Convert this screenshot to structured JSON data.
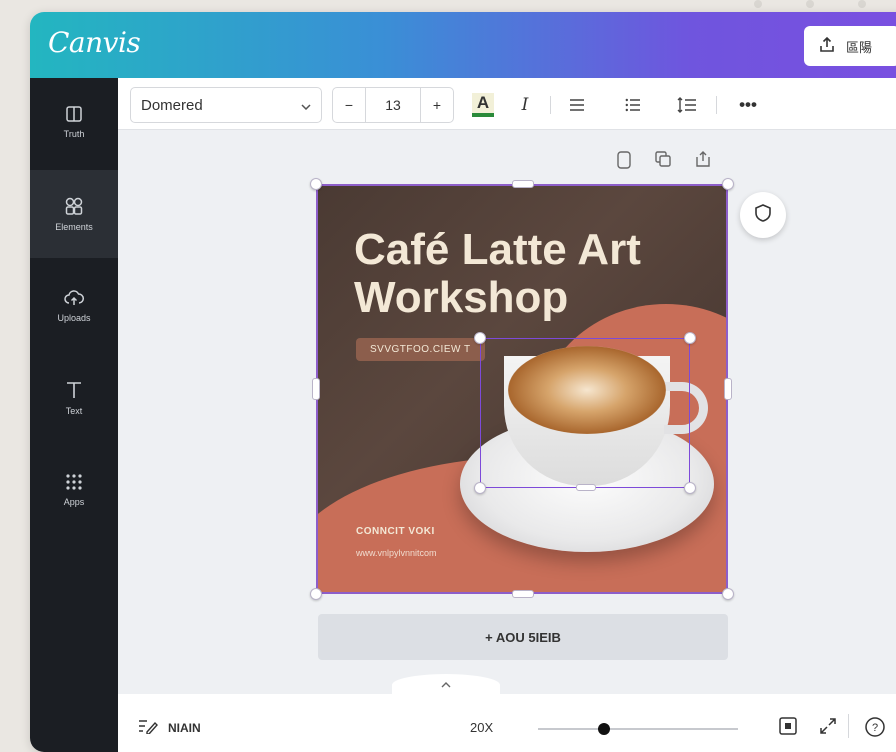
{
  "app": {
    "logo": "Canvis",
    "share_label": "區陽"
  },
  "sidebar": {
    "items": [
      {
        "label": "Truth",
        "icon": "template-icon"
      },
      {
        "label": "Elements",
        "icon": "elements-icon"
      },
      {
        "label": "Uploads",
        "icon": "upload-icon"
      },
      {
        "label": "Text",
        "icon": "text-icon"
      },
      {
        "label": "Apps",
        "icon": "apps-icon"
      }
    ]
  },
  "toolbar": {
    "font": "Domered",
    "font_size": "13",
    "minus": "−",
    "plus": "+",
    "color_letter": "A",
    "italic_letter": "I",
    "more": "•••"
  },
  "design": {
    "headline": "Café Latte Art Workshop",
    "date_text": "SVVGTFOO.CIEW T",
    "contact_text": "CONNCIT VOKI",
    "url_text": "www.vnlpylvnnitcom"
  },
  "add_page": "+ AOU 5IEIB",
  "bottom": {
    "notes_label": "NIAIN",
    "zoom": "20X"
  },
  "colors": {
    "brand_gradient_start": "#23b6c0",
    "brand_gradient_end": "#7a4fe0",
    "selection": "#7d4ad9",
    "design_accent": "#c86e58",
    "sidebar_bg": "#1b1e23"
  },
  "zoom_slider_value": 0.33
}
